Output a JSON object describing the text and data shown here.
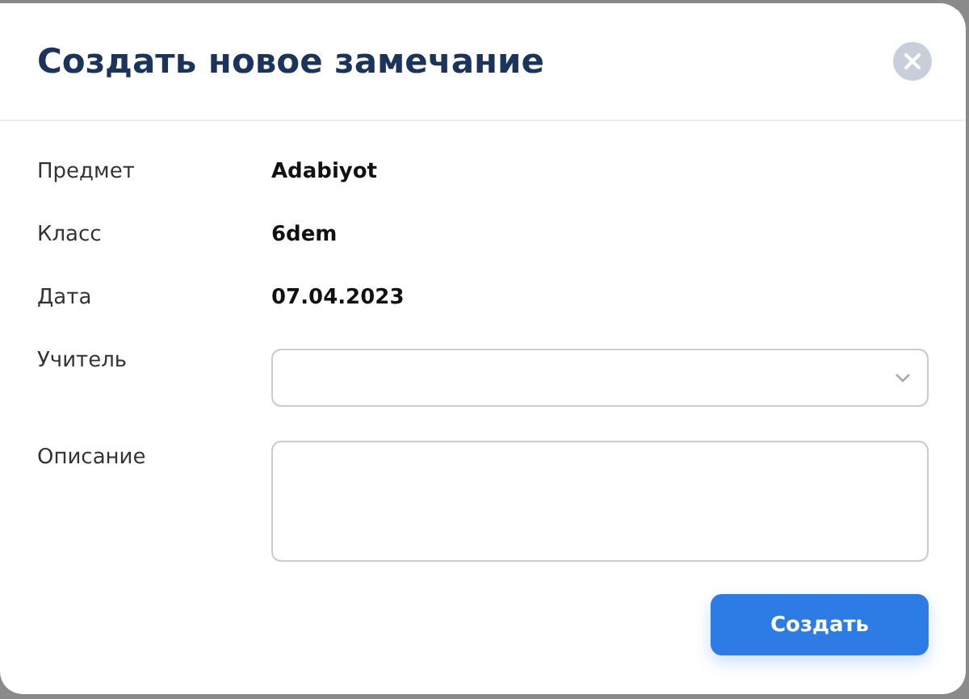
{
  "dialog": {
    "title": "Создать новое замечание",
    "info_rows": [
      {
        "label": "Предмет",
        "value": "Adabiyot"
      },
      {
        "label": "Класс",
        "value": "6dem"
      },
      {
        "label": "Дата",
        "value": "07.04.2023"
      }
    ],
    "teacher": {
      "label": "Учитель"
    },
    "description": {
      "label": "Описание"
    },
    "submit": "Создать"
  }
}
